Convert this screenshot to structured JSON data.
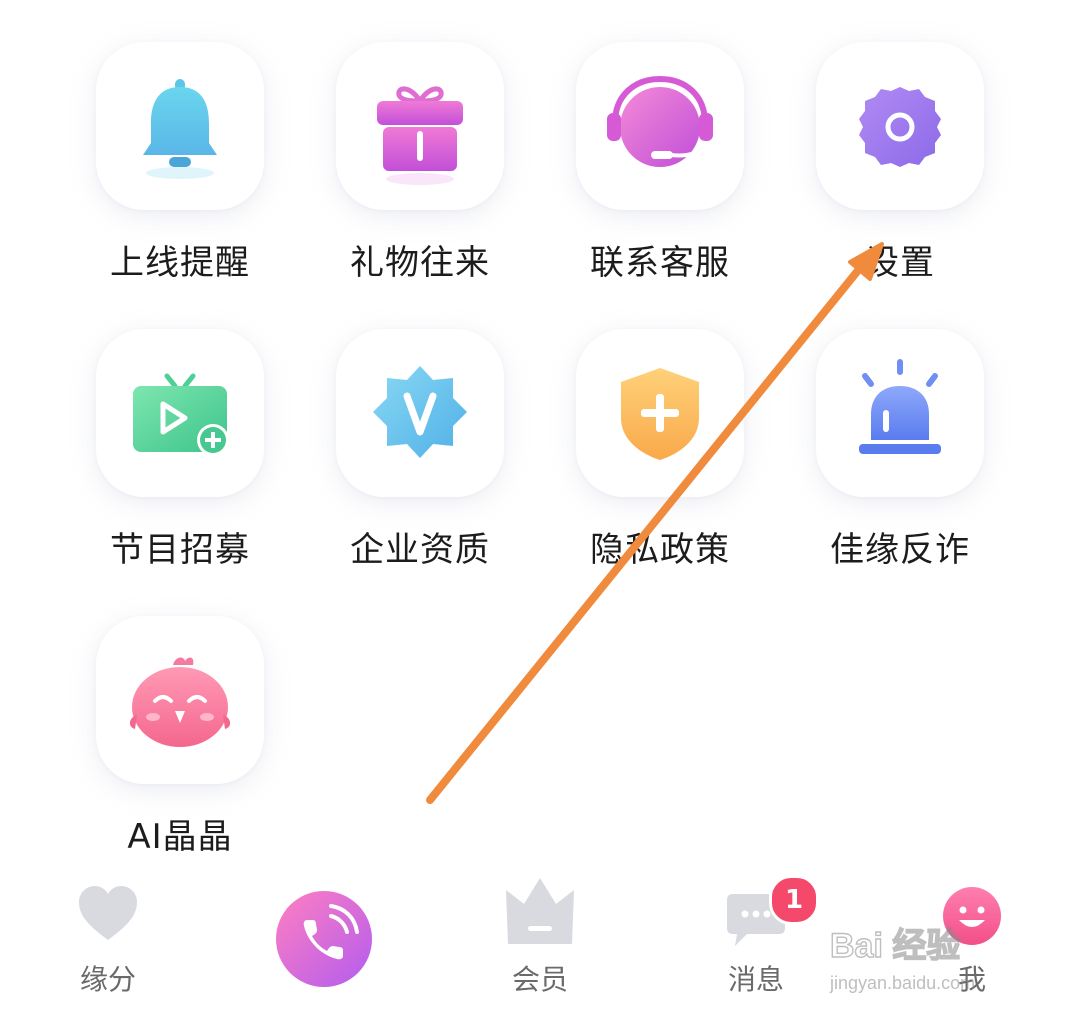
{
  "grid": {
    "items": [
      {
        "label": "上线提醒",
        "icon": "bell-icon"
      },
      {
        "label": "礼物往来",
        "icon": "gift-icon"
      },
      {
        "label": "联系客服",
        "icon": "headset-icon"
      },
      {
        "label": "设置",
        "icon": "gear-icon"
      },
      {
        "label": "节目招募",
        "icon": "tv-add-icon"
      },
      {
        "label": "企业资质",
        "icon": "verified-badge-icon"
      },
      {
        "label": "隐私政策",
        "icon": "shield-plus-icon"
      },
      {
        "label": "佳缘反诈",
        "icon": "alarm-light-icon"
      },
      {
        "label": "AI晶晶",
        "icon": "bird-mascot-icon"
      }
    ]
  },
  "bottom_nav": {
    "items": [
      {
        "label": "缘分",
        "icon": "heart-icon"
      },
      {
        "label": "",
        "icon": "phone-call-icon"
      },
      {
        "label": "会员",
        "icon": "crown-icon"
      },
      {
        "label": "消息",
        "icon": "chat-bubble-icon",
        "badge": "1"
      },
      {
        "label": "我",
        "icon": "smiley-profile-icon"
      }
    ]
  },
  "watermark": {
    "brand": "Bai 经验",
    "url": "jingyan.baidu.com"
  },
  "colors": {
    "arrow": "#f08a3c",
    "badge": "#f4496b",
    "nav_inactive": "#d9dadf"
  }
}
